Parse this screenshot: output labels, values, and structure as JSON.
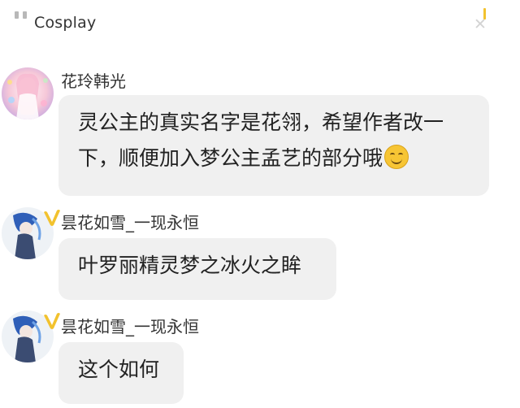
{
  "header": {
    "title": "Cosplay",
    "menu_icon": "pause-bars-icon",
    "close_icon": "close-icon"
  },
  "messages": [
    {
      "username": "花玲韩光",
      "text_lines": [
        "灵公主的真实名字是花翎，希望作者改一",
        "下，顺便加入梦公主孟艺的部分哦"
      ],
      "emoji": "smiling-face-icon",
      "verified": false
    },
    {
      "username": "昙花如雪_一现永恒",
      "text_lines": [
        "叶罗丽精灵梦之冰火之眸"
      ],
      "verified": true
    },
    {
      "username": "昙花如雪_一现永恒",
      "text_lines": [
        "这个如何"
      ],
      "verified": true
    }
  ],
  "colors": {
    "bubble_bg": "#f0f0f0",
    "badge_gold": "#f2c22e",
    "text": "#222222"
  }
}
